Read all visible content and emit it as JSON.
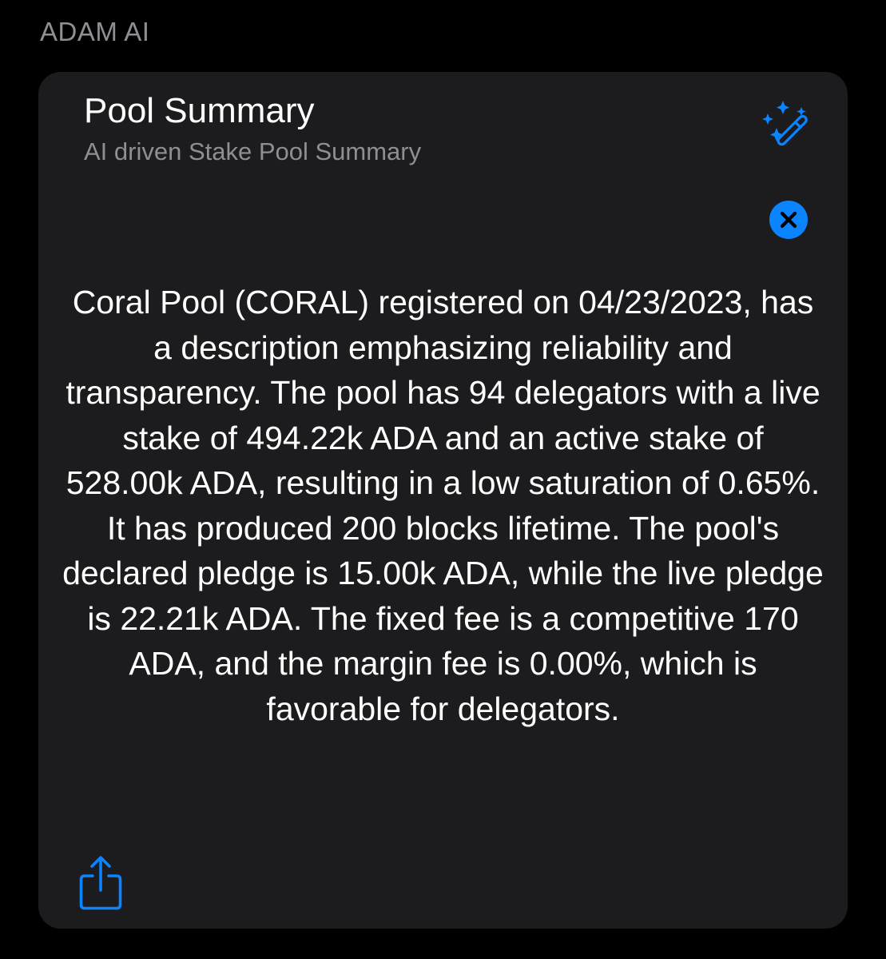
{
  "section": {
    "title": "ADAM AI"
  },
  "card": {
    "title": "Pool Summary",
    "subtitle": "AI driven Stake Pool Summary",
    "summary": "Coral Pool (CORAL) registered on 04/23/2023, has a description emphasizing reliability and transparency. The pool has 94 delegators with a live stake of 494.22k ADA and an active stake of 528.00k ADA, resulting in a low saturation of 0.65%. It has produced 200 blocks lifetime. The pool's declared pledge is 15.00k ADA, while the live pledge is 22.21k ADA. The fixed fee is a competitive 170 ADA, and the margin fee is 0.00%, which is favorable for delegators."
  },
  "icons": {
    "magic": "magic-wand-sparkles-icon",
    "close": "xmark-circle-fill-icon",
    "share": "square-and-arrow-up-icon"
  },
  "colors": {
    "background": "#000000",
    "card": "#1c1c1e",
    "accent": "#0a84ff",
    "secondary_text": "#8e8e93",
    "primary_text": "#ffffff"
  }
}
